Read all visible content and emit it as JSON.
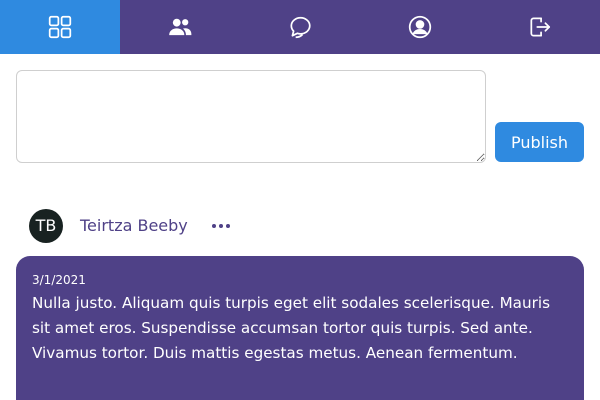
{
  "nav": {
    "items": [
      {
        "icon": "grid-icon",
        "active": true
      },
      {
        "icon": "users-icon",
        "active": false
      },
      {
        "icon": "chat-icon",
        "active": false
      },
      {
        "icon": "profile-icon",
        "active": false
      },
      {
        "icon": "logout-icon",
        "active": false
      }
    ],
    "colors": {
      "bar": "#4f4187",
      "active": "#2f8ae0"
    }
  },
  "composer": {
    "value": "",
    "placeholder": ""
  },
  "publish": {
    "label": "Publish"
  },
  "post": {
    "author": {
      "initials": "TB",
      "name": "Teirtza Beeby"
    },
    "more_icon": "more-horizontal-icon",
    "date": "3/1/2021",
    "body": "Nulla justo. Aliquam quis turpis eget elit sodales scelerisque. Mauris sit amet eros. Suspendisse accumsan tortor quis turpis. Sed ante. Vivamus tortor. Duis mattis egestas metus. Aenean fermentum."
  }
}
